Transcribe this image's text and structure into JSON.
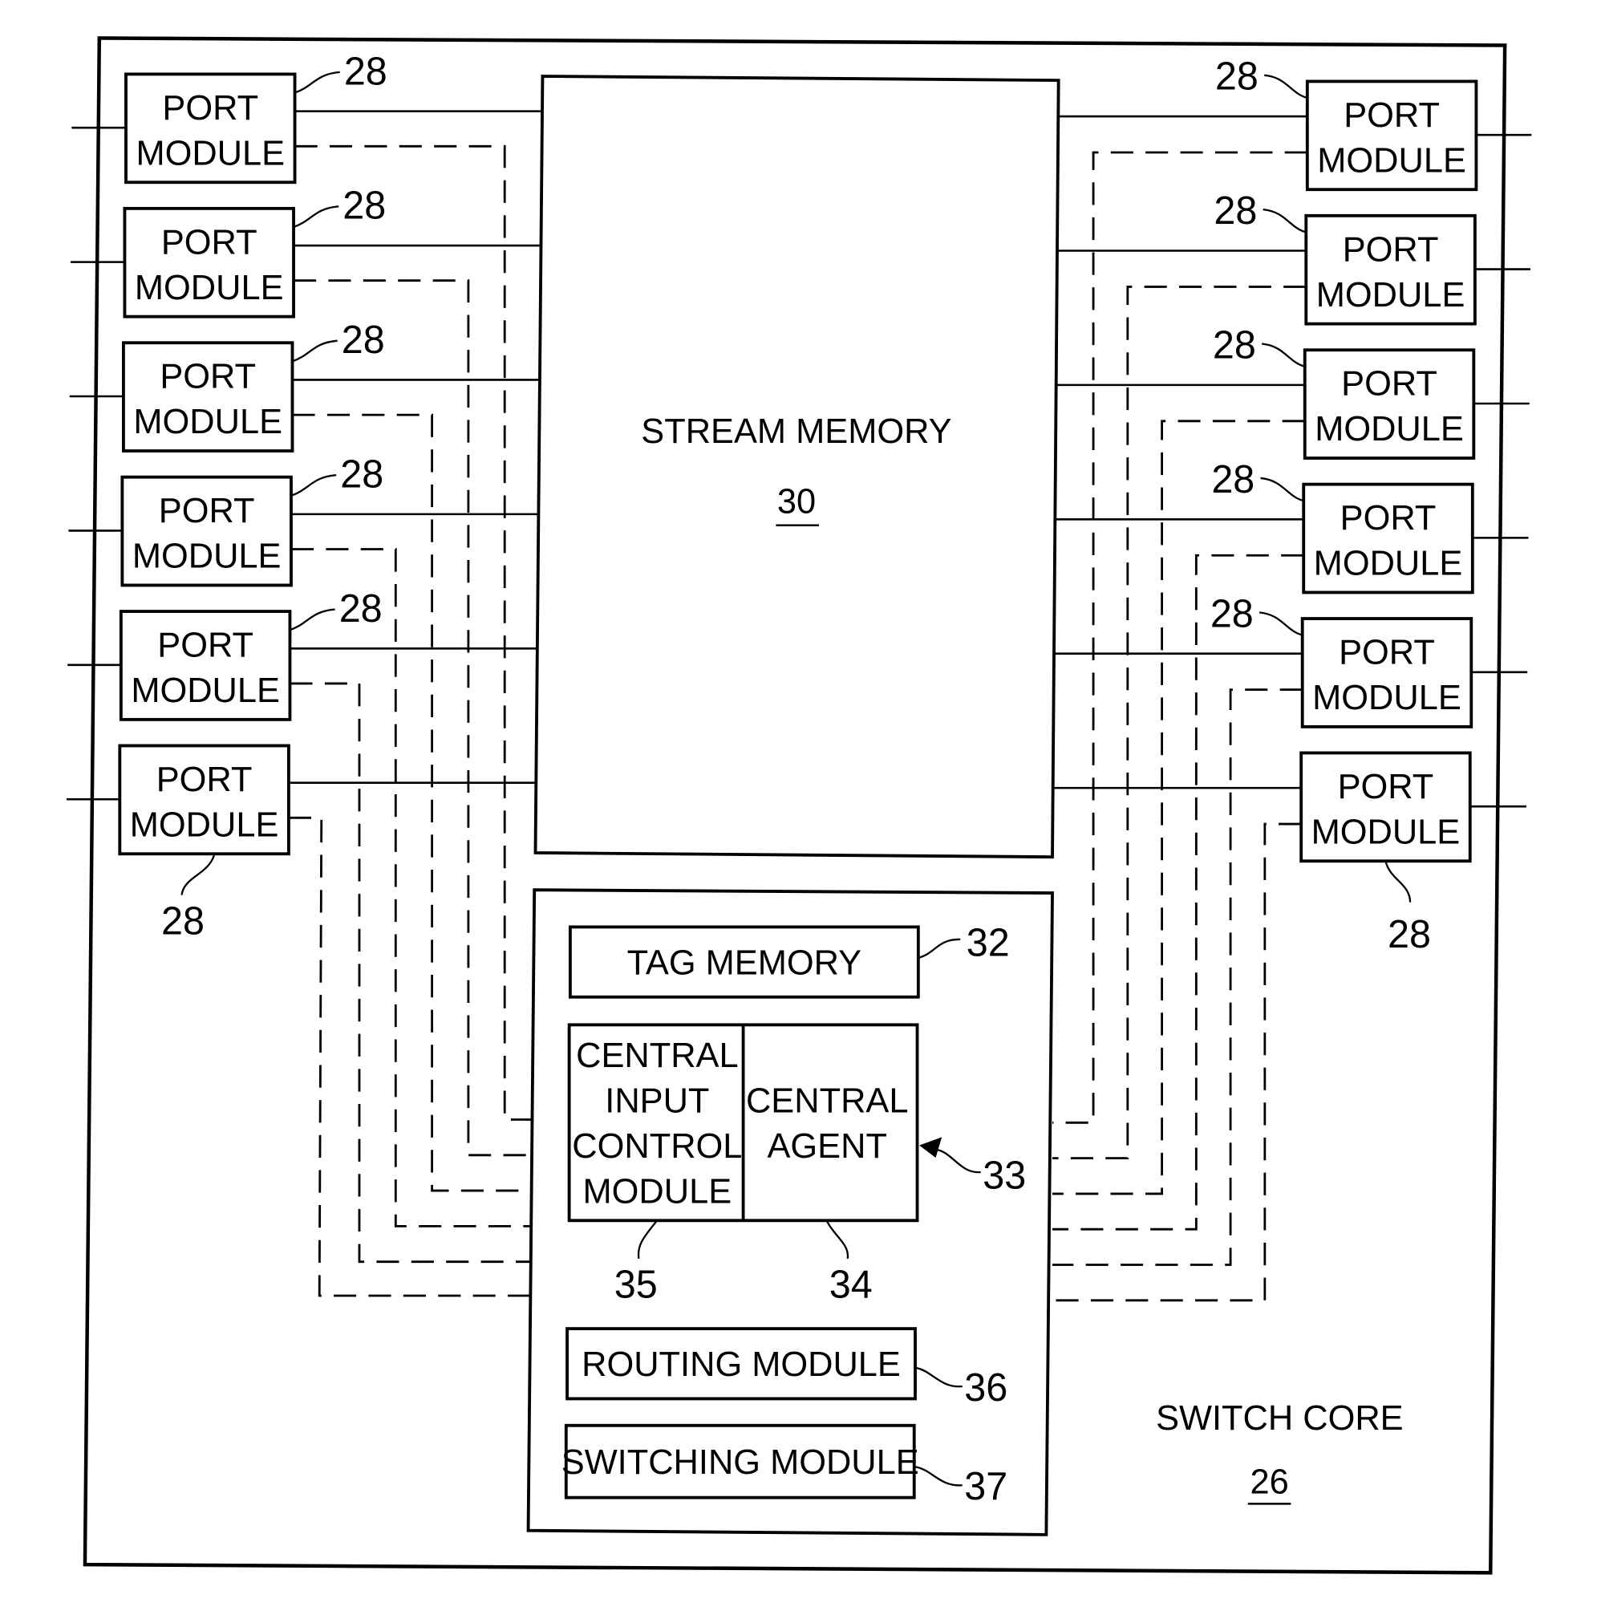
{
  "diagram": {
    "title": "SWITCH CORE",
    "title_ref": "26",
    "stream_memory": {
      "label": "STREAM MEMORY",
      "ref": "30"
    },
    "port_module": {
      "line1": "PORT",
      "line2": "MODULE",
      "ref": "28"
    },
    "left_ports": 6,
    "right_ports": 6,
    "tag_memory": {
      "label": "TAG MEMORY",
      "ref": "32"
    },
    "central_group_ref": "33",
    "central_input_control_module": {
      "lines": [
        "CENTRAL",
        "INPUT",
        "CONTROL",
        "MODULE"
      ],
      "ref": "35"
    },
    "central_agent": {
      "lines": [
        "CENTRAL",
        "AGENT"
      ],
      "ref": "34"
    },
    "routing_module": {
      "label": "ROUTING MODULE",
      "ref": "36"
    },
    "switching_module": {
      "label": "SWITCHING MODULE",
      "ref": "37"
    },
    "edges": {
      "solid": "port module ↔ stream memory (data path)",
      "dashed": "port module ↔ central input control module / central agent (control path)"
    }
  }
}
